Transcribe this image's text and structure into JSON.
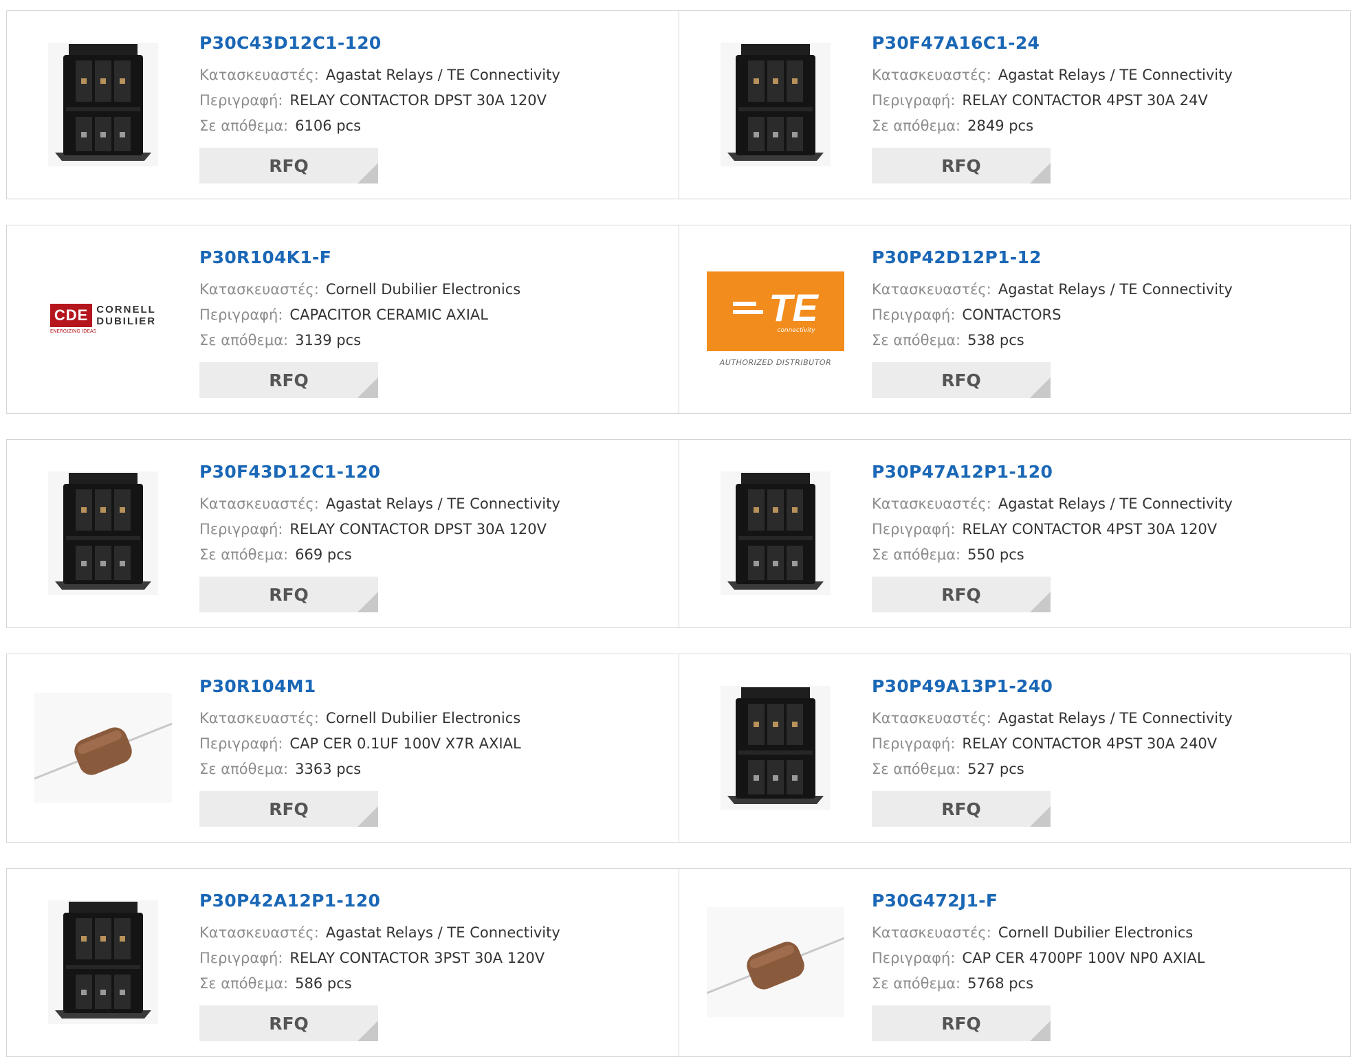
{
  "products": [
    {
      "part": "P30C43D12C1-120",
      "image": "contactor",
      "manufacturer": "Agastat Relays / TE Connectivity",
      "description": "RELAY CONTACTOR DPST 30A 120V",
      "stock": "6106 pcs"
    },
    {
      "part": "P30F47A16C1-24",
      "image": "contactor",
      "manufacturer": "Agastat Relays / TE Connectivity",
      "description": "RELAY CONTACTOR 4PST 30A 24V",
      "stock": "2849 pcs"
    },
    {
      "part": "P30R104K1-F",
      "image": "cde-logo",
      "manufacturer": "Cornell Dubilier Electronics",
      "description": "CAPACITOR CERAMIC AXIAL",
      "stock": "3139 pcs"
    },
    {
      "part": "P30P42D12P1-12",
      "image": "te-logo",
      "manufacturer": "Agastat Relays / TE Connectivity",
      "description": "CONTACTORS",
      "stock": "538 pcs"
    },
    {
      "part": "P30F43D12C1-120",
      "image": "contactor",
      "manufacturer": "Agastat Relays / TE Connectivity",
      "description": "RELAY CONTACTOR DPST 30A 120V",
      "stock": "669 pcs"
    },
    {
      "part": "P30P47A12P1-120",
      "image": "contactor",
      "manufacturer": "Agastat Relays / TE Connectivity",
      "description": "RELAY CONTACTOR 4PST 30A 120V",
      "stock": "550 pcs"
    },
    {
      "part": "P30R104M1",
      "image": "capacitor",
      "manufacturer": "Cornell Dubilier Electronics",
      "description": "CAP CER 0.1UF 100V X7R AXIAL",
      "stock": "3363 pcs"
    },
    {
      "part": "P30P49A13P1-240",
      "image": "contactor",
      "manufacturer": "Agastat Relays / TE Connectivity",
      "description": "RELAY CONTACTOR 4PST 30A 240V",
      "stock": "527 pcs"
    },
    {
      "part": "P30P42A12P1-120",
      "image": "contactor",
      "manufacturer": "Agastat Relays / TE Connectivity",
      "description": "RELAY CONTACTOR 3PST 30A 120V",
      "stock": "586 pcs"
    },
    {
      "part": "P30G472J1-F",
      "image": "capacitor",
      "manufacturer": "Cornell Dubilier Electronics",
      "description": "CAP CER 4700PF 100V NP0 AXIAL",
      "stock": "5768 pcs"
    }
  ],
  "labels": {
    "manufacturer": "Κατασκευαστές:",
    "description": "Περιγραφή:",
    "stock": "Σε απόθεμα:",
    "rfq": "RFQ"
  },
  "logos": {
    "cde": {
      "mark": "CDE",
      "line1": "CORNELL",
      "line2": "DUBILIER",
      "tagline": "ENERGIZING IDEAS"
    },
    "te": {
      "mark": "TE",
      "sub": "connectivity",
      "caption": "AUTHORIZED DISTRIBUTOR"
    }
  },
  "colors": {
    "part_link": "#1a67b6",
    "label": "#8c8c8c",
    "value": "#333333",
    "rfq_bg": "#ececec",
    "te_orange": "#f28c1c",
    "cde_red": "#b5161d"
  }
}
